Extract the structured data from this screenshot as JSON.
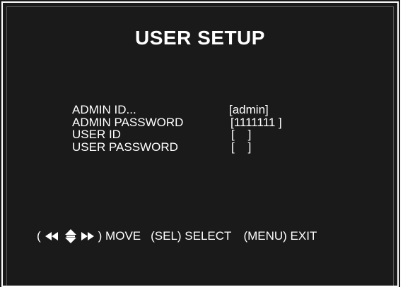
{
  "screen": {
    "title": "USER SETUP",
    "colors": {
      "background": "#1a1a1a",
      "text": "#ffffff"
    }
  },
  "fields": [
    {
      "label": "ADMIN ID...",
      "value": "[admin]"
    },
    {
      "label": "ADMIN PASSWORD",
      "value": "[1111111 ]"
    },
    {
      "label": "USER ID",
      "value": "[    ]"
    },
    {
      "label": "USER PASSWORD",
      "value": "[    ]"
    }
  ],
  "help": {
    "move_open": "(",
    "nav_icon": "arrow-keys-icon",
    "move_label": ") MOVE",
    "select_label": "(SEL) SELECT",
    "exit_label": "(MENU) EXIT"
  }
}
